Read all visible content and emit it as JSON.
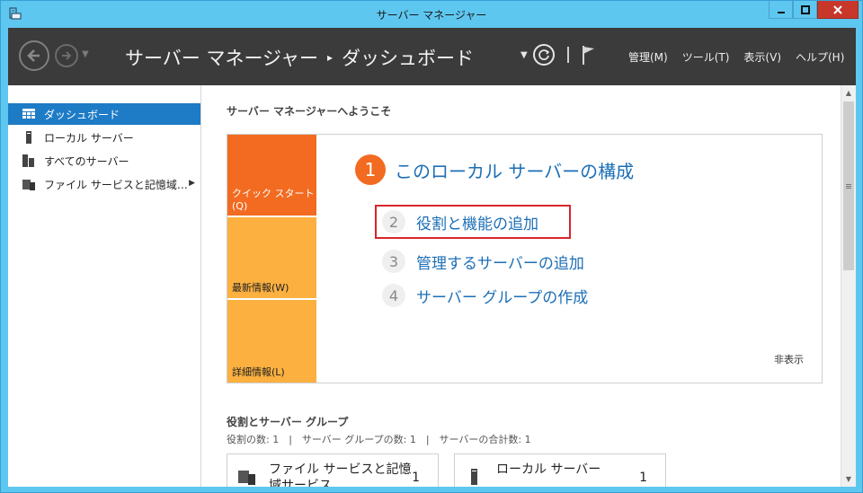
{
  "window": {
    "title": "サーバー マネージャー"
  },
  "header": {
    "breadcrumb_root": "サーバー マネージャー",
    "breadcrumb_sep": "▸",
    "breadcrumb_current": "ダッシュボード",
    "menus": [
      "管理(M)",
      "ツール(T)",
      "表示(V)",
      "ヘルプ(H)"
    ]
  },
  "sidebar": {
    "items": [
      {
        "label": "ダッシュボード",
        "icon": "dashboard-icon"
      },
      {
        "label": "ローカル サーバー",
        "icon": "server-icon"
      },
      {
        "label": "すべてのサーバー",
        "icon": "servers-icon"
      },
      {
        "label": "ファイル サービスと記憶域…",
        "icon": "file-services-icon"
      }
    ],
    "active_index": 0
  },
  "main": {
    "welcome": "サーバー マネージャーへようこそ",
    "tiles": {
      "quick": "クイック スタート(Q)",
      "new": "最新情報(W)",
      "more": "詳細情報(L)"
    },
    "step1": {
      "num": "1",
      "label": "このローカル サーバーの構成"
    },
    "steps": [
      {
        "num": "2",
        "label": "役割と機能の追加"
      },
      {
        "num": "3",
        "label": "管理するサーバーの追加"
      },
      {
        "num": "4",
        "label": "サーバー グループの作成"
      }
    ],
    "hide_label": "非表示",
    "groups_title": "役割とサーバー グループ",
    "groups_summary": "役割の数: 1　|　サーバー グループの数: 1　|　サーバーの合計数: 1",
    "cards": [
      {
        "title": "ファイル サービスと記憶域サービス",
        "count": "1"
      },
      {
        "title": "ローカル サーバー",
        "count": "1"
      }
    ]
  },
  "colors": {
    "accent_orange": "#f26b21",
    "tile_yellow": "#fbb040",
    "link_blue": "#1c6fb6",
    "highlight_red": "#d9252a",
    "header_dark": "#3b3b3b",
    "titlebar": "#5ec7f0"
  }
}
